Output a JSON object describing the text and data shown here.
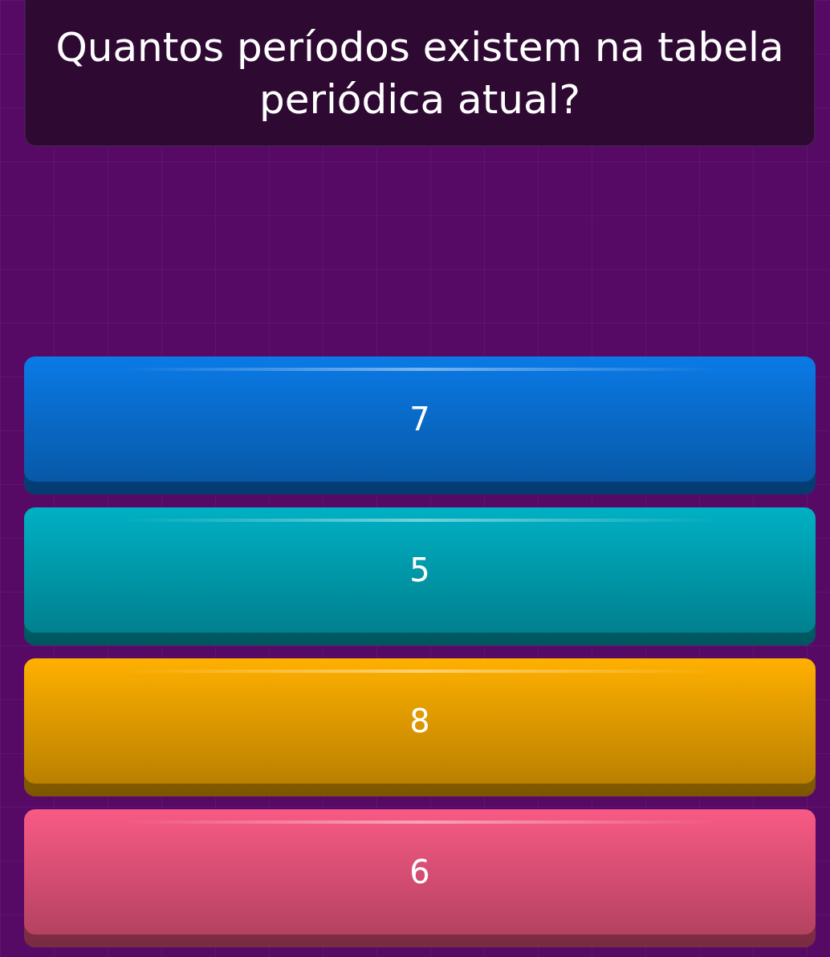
{
  "question": {
    "text": "Quantos períodos existem na tabela periódica atual?"
  },
  "answers": [
    {
      "label": "7",
      "color": "#0a7ae6"
    },
    {
      "label": "5",
      "color": "#00b0c4"
    },
    {
      "label": "8",
      "color": "#ffb000"
    },
    {
      "label": "6",
      "color": "#f85a85"
    }
  ]
}
